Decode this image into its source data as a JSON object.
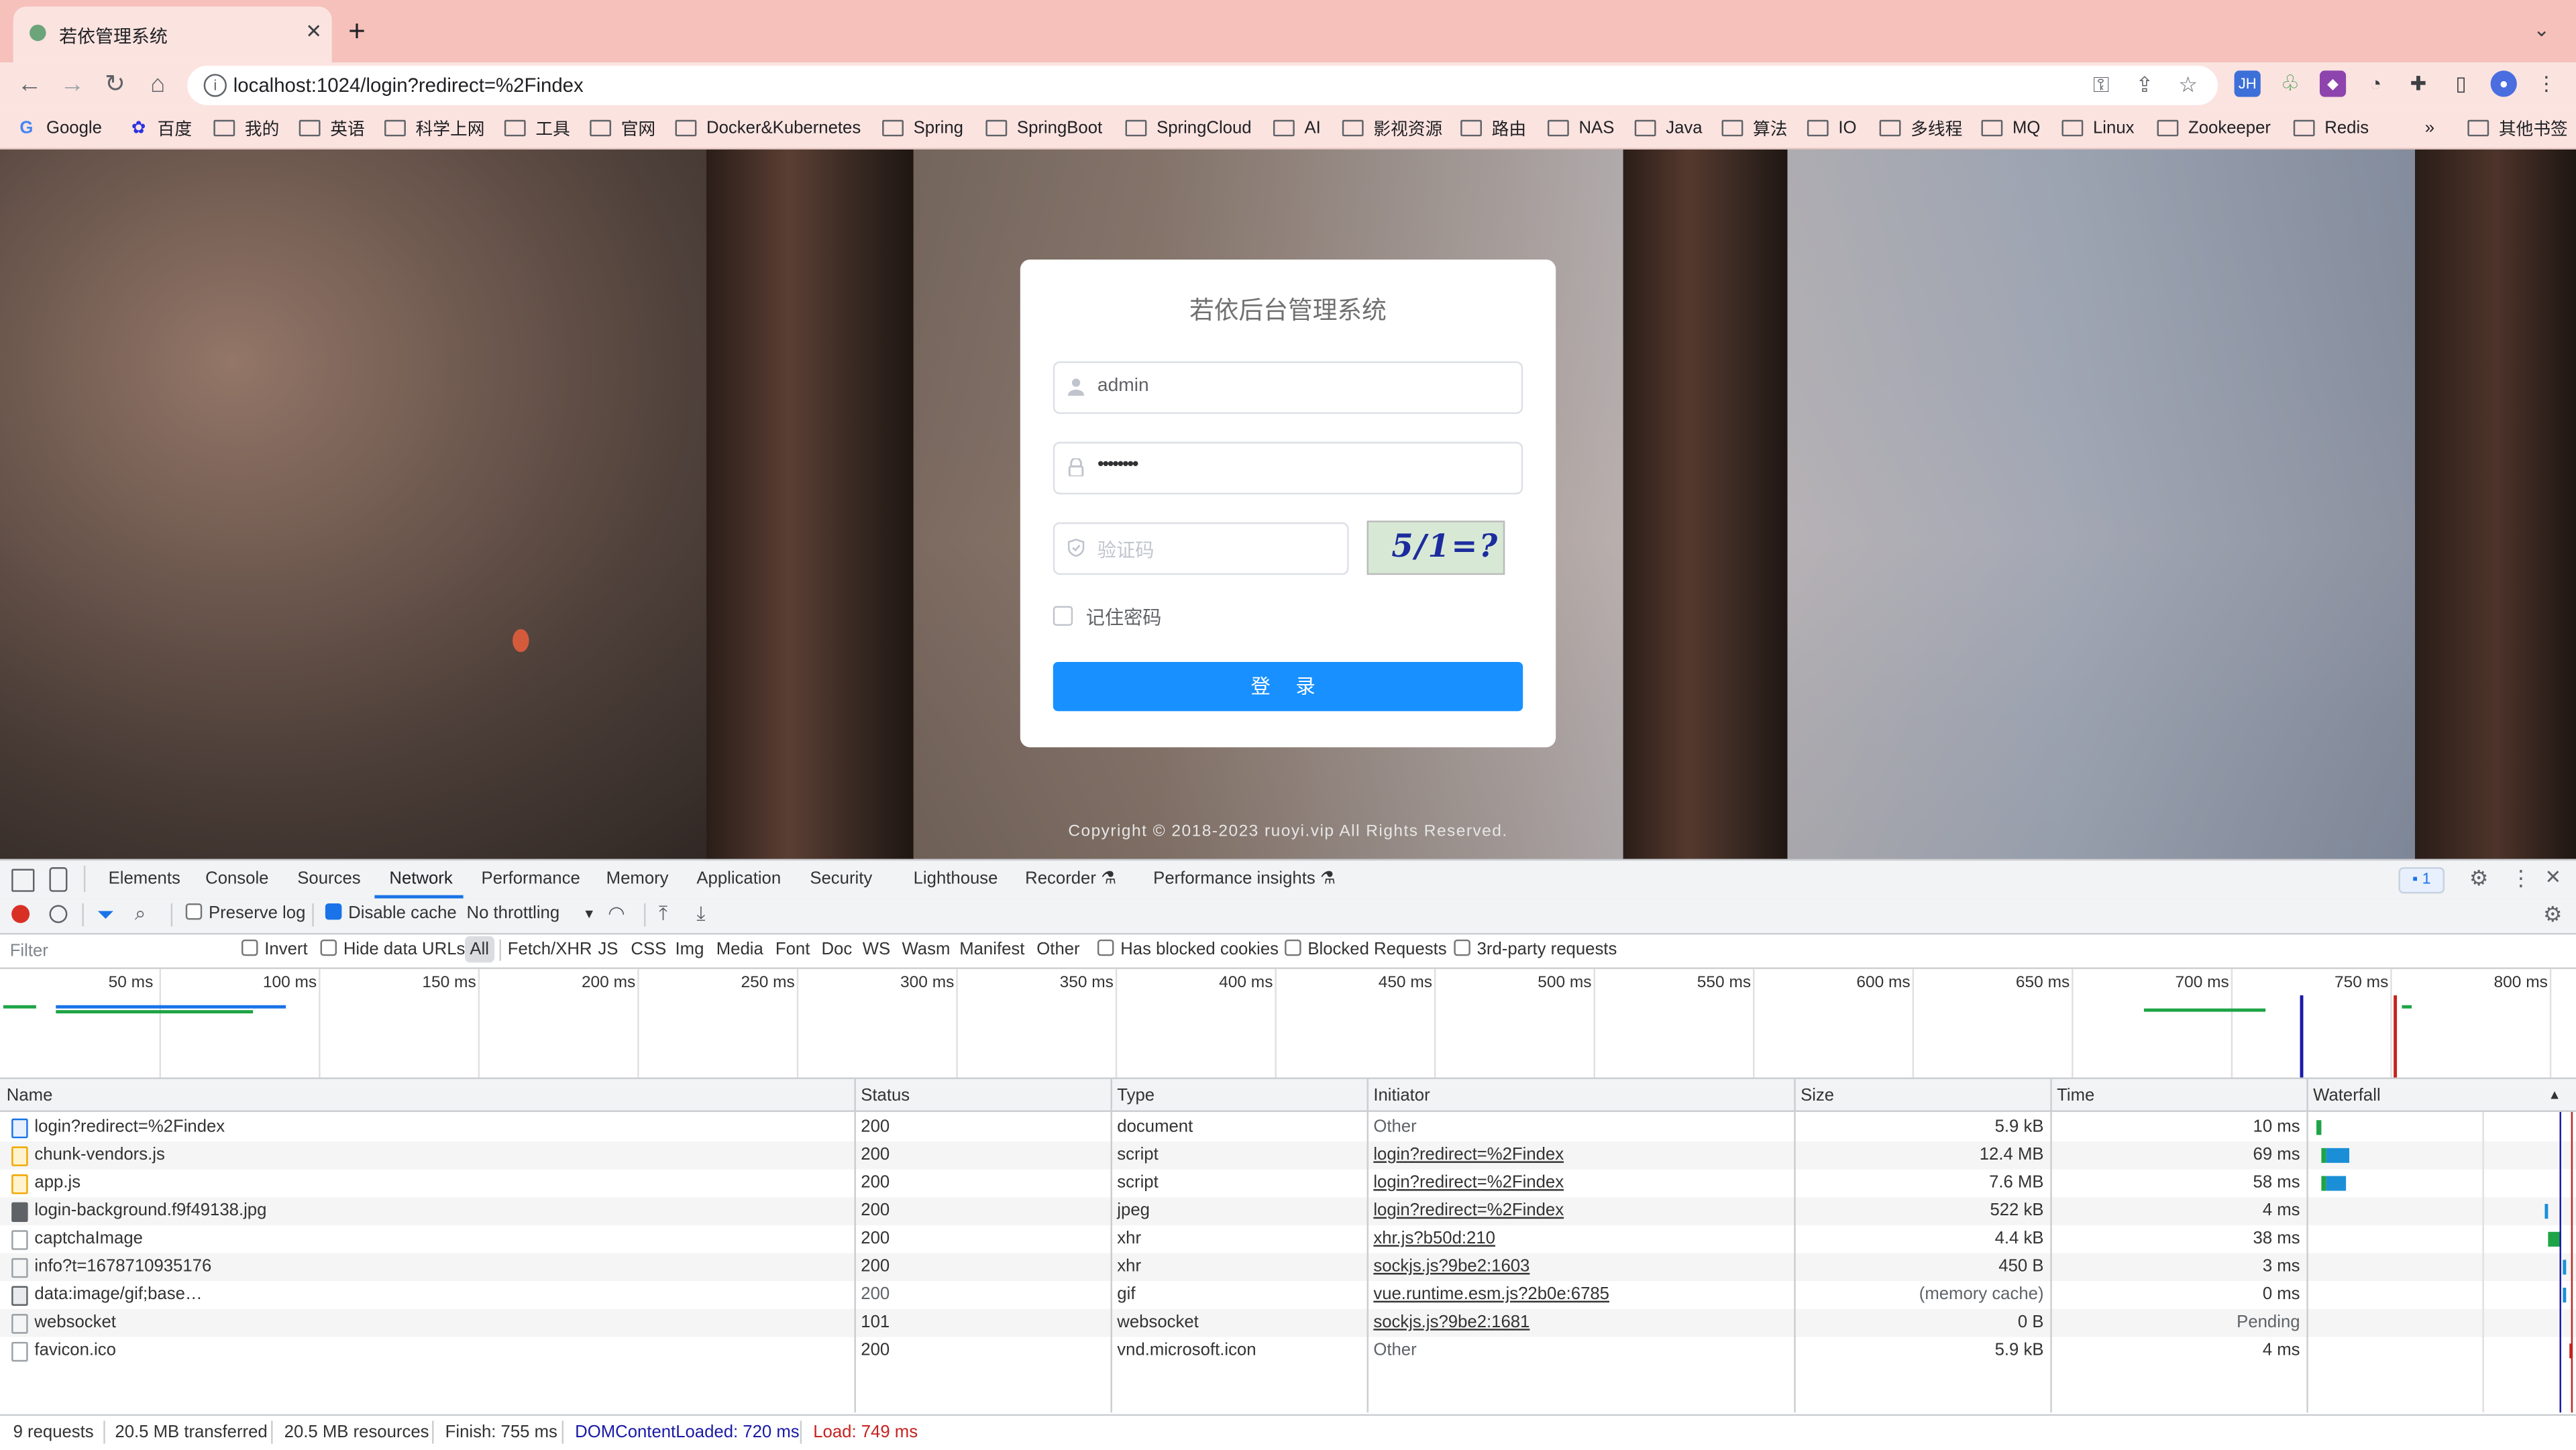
{
  "browser": {
    "tab_title": "若依管理系统",
    "url": "localhost:1024/login?redirect=%2Findex",
    "bookmarks": [
      "Google",
      "百度",
      "我的",
      "英语",
      "科学上网",
      "工具",
      "官网",
      "Docker&Kubernetes",
      "Spring",
      "SpringBoot",
      "SpringCloud",
      "AI",
      "影视资源",
      "路由",
      "NAS",
      "Java",
      "算法",
      "IO",
      "多线程",
      "MQ",
      "Linux",
      "Zookeeper",
      "Redis"
    ],
    "bookmarks_more": "»",
    "other_bookmarks": "其他书签",
    "extensions": [
      "JH"
    ]
  },
  "login": {
    "title": "若依后台管理系统",
    "username_value": "admin",
    "password_mask": "••••••••",
    "captcha_placeholder": "验证码",
    "captcha_text": "5/1=?",
    "remember_label": "记住密码",
    "login_button": "登 录",
    "copyright": "Copyright © 2018-2023 ruoyi.vip All Rights Reserved."
  },
  "devtools": {
    "tabs": [
      "Elements",
      "Console",
      "Sources",
      "Network",
      "Performance",
      "Memory",
      "Application",
      "Security",
      "Lighthouse",
      "Recorder ⚗",
      "Performance insights ⚗"
    ],
    "active_tab": "Network",
    "issues_badge": "1",
    "toolbar": {
      "preserve_log": "Preserve log",
      "disable_cache": "Disable cache",
      "throttling": "No throttling"
    },
    "filter": {
      "placeholder": "Filter",
      "invert": "Invert",
      "hide_data_urls": "Hide data URLs",
      "types": [
        "All",
        "Fetch/XHR",
        "JS",
        "CSS",
        "Img",
        "Media",
        "Font",
        "Doc",
        "WS",
        "Wasm",
        "Manifest",
        "Other"
      ],
      "has_blocked_cookies": "Has blocked cookies",
      "blocked_requests": "Blocked Requests",
      "third_party": "3rd-party requests"
    },
    "overview_ticks": [
      "50 ms",
      "100 ms",
      "150 ms",
      "200 ms",
      "250 ms",
      "300 ms",
      "350 ms",
      "400 ms",
      "450 ms",
      "500 ms",
      "550 ms",
      "600 ms",
      "650 ms",
      "700 ms",
      "750 ms",
      "800 ms"
    ],
    "columns": [
      "Name",
      "Status",
      "Type",
      "Initiator",
      "Size",
      "Time",
      "Waterfall"
    ],
    "rows": [
      {
        "name": "login?redirect=%2Findex",
        "status": "200",
        "type": "document",
        "initiator": "Other",
        "size": "5.9 kB",
        "time": "10 ms"
      },
      {
        "name": "chunk-vendors.js",
        "status": "200",
        "type": "script",
        "initiator": "login?redirect=%2Findex",
        "size": "12.4 MB",
        "time": "69 ms"
      },
      {
        "name": "app.js",
        "status": "200",
        "type": "script",
        "initiator": "login?redirect=%2Findex",
        "size": "7.6 MB",
        "time": "58 ms"
      },
      {
        "name": "login-background.f9f49138.jpg",
        "status": "200",
        "type": "jpeg",
        "initiator": "login?redirect=%2Findex",
        "size": "522 kB",
        "time": "4 ms"
      },
      {
        "name": "captchaImage",
        "status": "200",
        "type": "xhr",
        "initiator": "xhr.js?b50d:210",
        "size": "4.4 kB",
        "time": "38 ms"
      },
      {
        "name": "info?t=1678710935176",
        "status": "200",
        "type": "xhr",
        "initiator": "sockjs.js?9be2:1603",
        "size": "450 B",
        "time": "3 ms"
      },
      {
        "name": "data:image/gif;base…",
        "status": "200",
        "type": "gif",
        "initiator": "vue.runtime.esm.js?2b0e:6785",
        "size": "(memory cache)",
        "time": "0 ms"
      },
      {
        "name": "websocket",
        "status": "101",
        "type": "websocket",
        "initiator": "sockjs.js?9be2:1681",
        "size": "0 B",
        "time": "Pending"
      },
      {
        "name": "favicon.ico",
        "status": "200",
        "type": "vnd.microsoft.icon",
        "initiator": "Other",
        "size": "5.9 kB",
        "time": "4 ms"
      }
    ],
    "summary": {
      "requests": "9 requests",
      "transferred": "20.5 MB transferred",
      "resources": "20.5 MB resources",
      "finish": "Finish: 755 ms",
      "dcl": "DOMContentLoaded: 720 ms",
      "load": "Load: 749 ms"
    },
    "colors": {
      "dcl": "#1a1aa6",
      "load": "#c5221f",
      "accent": "#1a73e8"
    }
  }
}
